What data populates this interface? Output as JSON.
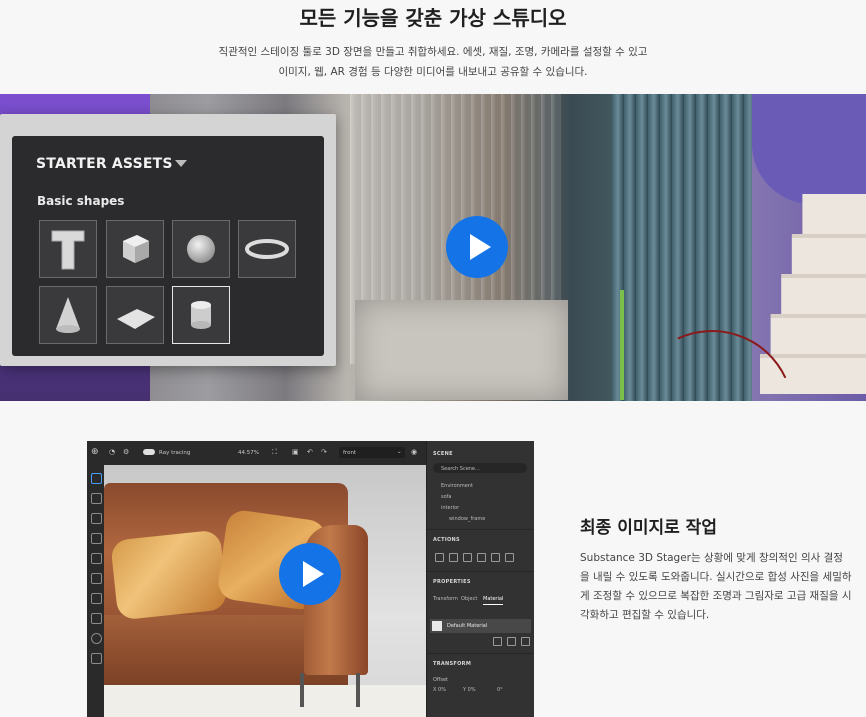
{
  "hero": {
    "title": "모든 기능을 갖춘 가상 스튜디오",
    "desc_line1": "직관적인 스테이징 툴로 3D 장면을 만들고 취합하세요. 에셋, 재질, 조명, 카메라를 설정할 수 있고",
    "desc_line2": "이미지, 웹, AR 경험 등 다양한 미디어를 내보내고 공유할 수 있습니다."
  },
  "assets_panel": {
    "title": "STARTER ASSETS",
    "section": "Basic shapes",
    "shapes": [
      "text-t",
      "cube",
      "sphere",
      "torus",
      "cone",
      "plane",
      "cylinder"
    ]
  },
  "app": {
    "toolbar": {
      "ray_tracing": "Ray tracing",
      "zoom": "44.57%",
      "camera": "front"
    },
    "scene": {
      "heading": "SCENE",
      "search_placeholder": "Search Scene...",
      "items": [
        "Environment",
        "sofa",
        "interior",
        "window_frame"
      ]
    },
    "actions_heading": "ACTIONS",
    "properties": {
      "heading": "PROPERTIES",
      "tabs": [
        "Transform",
        "Object",
        "Material"
      ],
      "active_tab": "Material",
      "material_name": "Default Material"
    },
    "transform": {
      "heading": "TRANSFORM",
      "offset_label": "Offset",
      "x": "X  0%",
      "y": "Y  0%",
      "r": "0°"
    }
  },
  "section2": {
    "title": "최종 이미지로 작업",
    "desc": "Substance 3D Stager는 상황에 맞게 창의적인 의사 결정을 내릴 수 있도록 도와줍니다. 실시간으로 합성 사진을 세밀하게 조정할 수 있으므로 복잡한 조명과 그림자로 고급 재질을 시각화하고 편집할 수 있습니다."
  },
  "colors": {
    "play_button": "#1473e6",
    "panel_dark": "#2b2a2c",
    "app_bg": "#323232"
  },
  "icons": [
    "play-icon",
    "chevron-down-icon"
  ]
}
